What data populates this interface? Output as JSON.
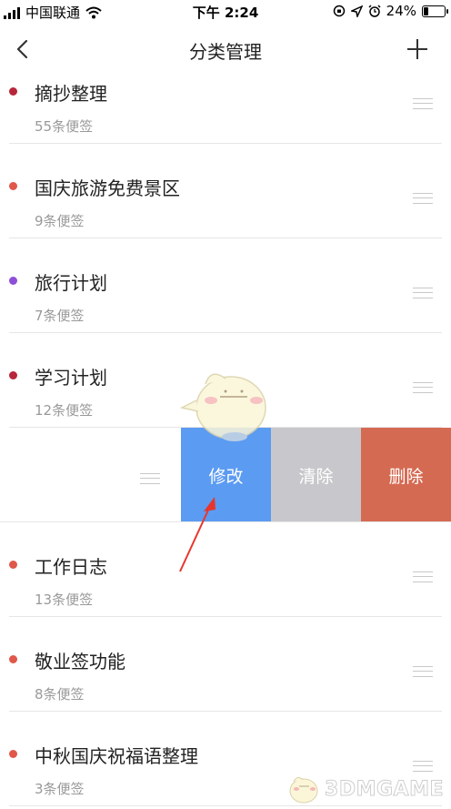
{
  "status_bar": {
    "carrier": "中国联通",
    "time": "下午 2:24",
    "battery_percent": "24%",
    "battery_level": 0.24
  },
  "nav": {
    "title": "分类管理",
    "back_icon": "chevron-left-icon",
    "add_icon": "plus-icon"
  },
  "categories": [
    {
      "title": "摘抄整理",
      "count": "55条便签",
      "color": "#b8263a"
    },
    {
      "title": "国庆旅游免费景区",
      "count": "9条便签",
      "color": "#e0584a"
    },
    {
      "title": "旅行计划",
      "count": "7条便签",
      "color": "#8e4fd8"
    },
    {
      "title": "学习计划",
      "count": "12条便签",
      "color": "#b8263a"
    },
    {
      "title": "",
      "count": "",
      "color": ""
    },
    {
      "title": "工作日志",
      "count": "13条便签",
      "color": "#e0584a"
    },
    {
      "title": "敬业签功能",
      "count": "8条便签",
      "color": "#e0584a"
    },
    {
      "title": "中秋国庆祝福语整理",
      "count": "3条便签",
      "color": "#e0584a"
    }
  ],
  "swipe_actions": {
    "edit": "修改",
    "clear": "清除",
    "delete": "删除",
    "edit_color": "#5b9bf2",
    "clear_color": "#c8c8cc",
    "delete_color": "#d56a52"
  },
  "annotation": {
    "arrow_color": "#e8352b"
  },
  "watermark": {
    "text": "3DMGAME"
  }
}
